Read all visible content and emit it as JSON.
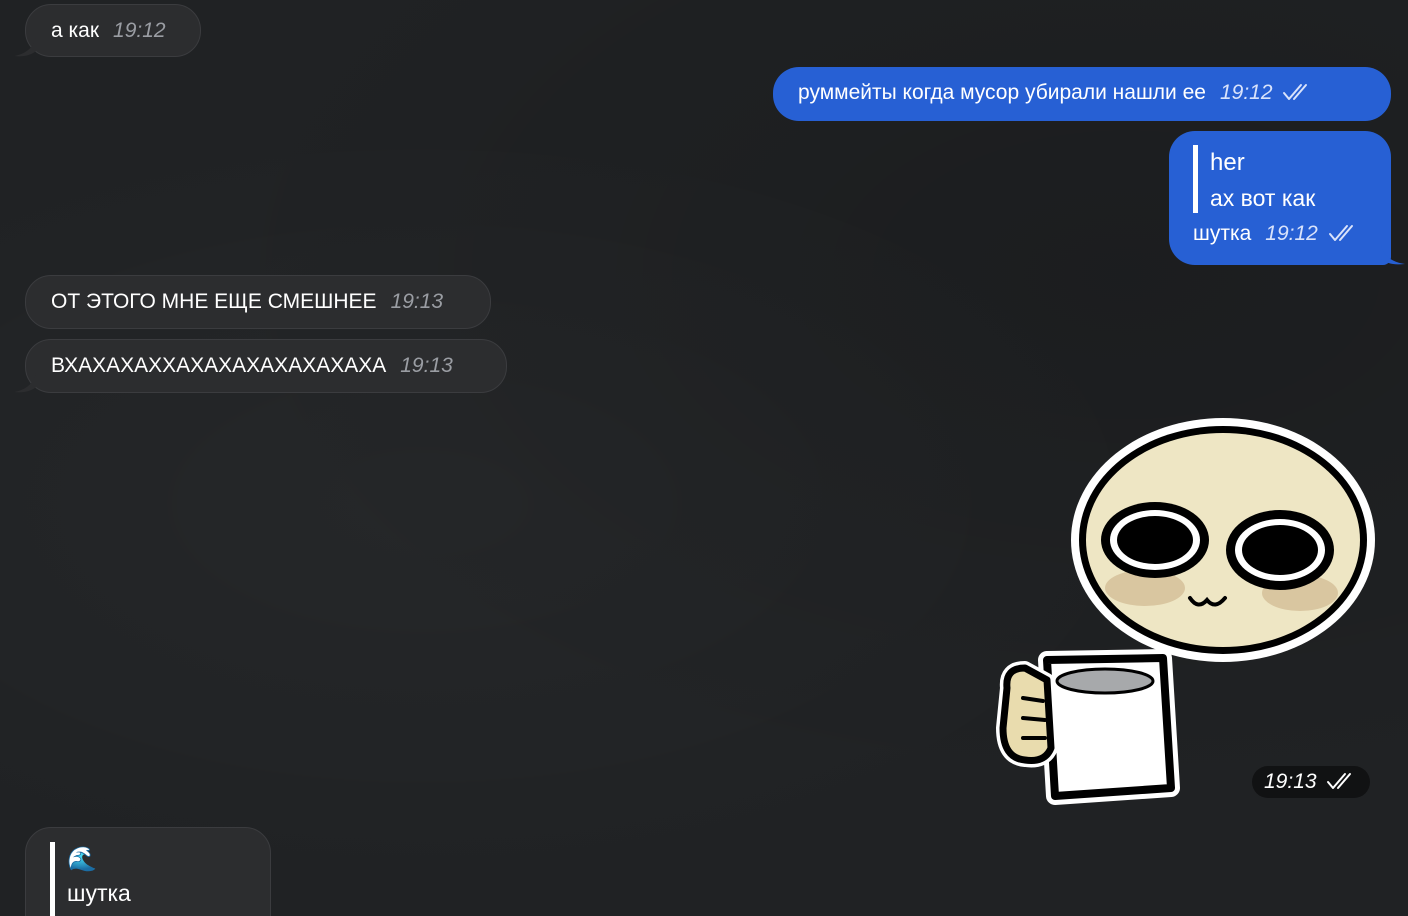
{
  "messages": [
    {
      "text": "а как",
      "time": "19:12"
    },
    {
      "text": "руммейты когда мусор убирали нашли ее",
      "time": "19:12"
    },
    {
      "reply_author": "her",
      "reply_text": "ах вот как",
      "text": "шутка",
      "time": "19:12"
    },
    {
      "text": "ОТ ЭТОГО МНЕ ЕЩЕ СМЕШНЕЕ",
      "time": "19:13"
    },
    {
      "text": "ВХАХАХАХХАХАХАХАХАХАХАХА",
      "time": "19:13"
    },
    {
      "sticker": "cup-holding-character-sticker",
      "time": "19:13"
    },
    {
      "reply_emoji": "🌊",
      "reply_text": "шутка"
    }
  ],
  "colors": {
    "background": "#202224",
    "incoming_bubble": "#2c2d2f",
    "outgoing_bubble": "#2760d4"
  },
  "icons": {
    "read_status": "double-check-icon"
  }
}
